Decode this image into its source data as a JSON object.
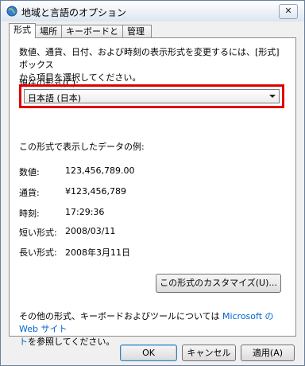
{
  "window": {
    "title": "地域と言語のオプション",
    "close_glyph": "✕"
  },
  "tabs": [
    {
      "label": "形式",
      "active": true
    },
    {
      "label": "場所",
      "active": false
    },
    {
      "label": "キーボードと言語",
      "active": false
    },
    {
      "label": "管理",
      "active": false
    }
  ],
  "panel": {
    "description_line1": "数値、通貨、日付、および時刻の表示形式を変更するには、[形式] ボックス",
    "description_line2": "から項目を選択してください。",
    "current_format_label": "現在の形式(C):",
    "current_format_value": "日本語 (日本)",
    "example_heading": "この形式で表示したデータの例:",
    "examples": [
      {
        "label": "数値:",
        "value": "123,456,789.00"
      },
      {
        "label": "通貨:",
        "value": "¥123,456,789"
      },
      {
        "label": "時刻:",
        "value": "17:29:36"
      },
      {
        "label": "短い形式:",
        "value": "2008/03/11"
      },
      {
        "label": "長い形式:",
        "value": "2008年3月11日"
      }
    ],
    "customize_button": "この形式のカスタマイズ(U)...",
    "footer_line1_prefix": "その他の形式、キーボードおよびツールについては",
    "footer_link": " Microsoft の Web サイト",
    "footer_line2_link": "ト",
    "footer_line2_suffix": "を参照してください。"
  },
  "buttons": {
    "ok": "OK",
    "cancel": "キャンセル",
    "apply": "適用(A)"
  },
  "colors": {
    "highlight_border": "#e00000",
    "link": "#0066cc"
  }
}
